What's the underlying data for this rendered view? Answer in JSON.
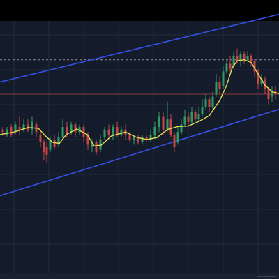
{
  "theme": {
    "top_bar": "#000000",
    "panel_bg": "#141c2b",
    "grid": "#232b3b",
    "channel": "#3550e6",
    "ma": "#e7dc55",
    "up": "#2f9a66",
    "down": "#c64545",
    "dash_line": "#8c8f98",
    "red_hline": "#8a3a3e",
    "bottom_bar": "#1a2230"
  },
  "chart_data": {
    "type": "candlestick",
    "title": "",
    "xlabel": "",
    "ylabel": "",
    "grid": true,
    "x_range": [
      0,
      400
    ],
    "y_range": [
      0,
      100
    ],
    "channel_upper": [
      {
        "x": 0,
        "y": 75.8
      },
      {
        "x": 400,
        "y": 102.6
      }
    ],
    "channel_lower": [
      {
        "x": 0,
        "y": 30.8
      },
      {
        "x": 400,
        "y": 65.0
      }
    ],
    "resistance_dashed": 84.6,
    "red_horizontal": 71.0,
    "ma_points": [
      [
        0,
        55.0
      ],
      [
        20,
        56.0
      ],
      [
        40,
        57.8
      ],
      [
        55,
        57.5
      ],
      [
        65,
        54.5
      ],
      [
        75,
        52.0
      ],
      [
        85,
        51.5
      ],
      [
        95,
        55.0
      ],
      [
        110,
        57.2
      ],
      [
        125,
        55.0
      ],
      [
        135,
        50.5
      ],
      [
        145,
        50.8
      ],
      [
        160,
        54.5
      ],
      [
        180,
        56.0
      ],
      [
        195,
        54.0
      ],
      [
        210,
        53.0
      ],
      [
        225,
        53.8
      ],
      [
        240,
        57.0
      ],
      [
        255,
        58.2
      ],
      [
        270,
        58.4
      ],
      [
        285,
        60.2
      ],
      [
        300,
        62.5
      ],
      [
        315,
        68.5
      ],
      [
        325,
        74.5
      ],
      [
        333,
        81.5
      ],
      [
        340,
        84.2
      ],
      [
        350,
        84.6
      ],
      [
        360,
        83.6
      ],
      [
        370,
        79.0
      ],
      [
        380,
        74.5
      ],
      [
        390,
        72.0
      ],
      [
        400,
        71.2
      ]
    ],
    "candles": [
      [
        4,
        57,
        56,
        58,
        55
      ],
      [
        10,
        55,
        57,
        58,
        54
      ],
      [
        16,
        58,
        55,
        59,
        54
      ],
      [
        22,
        56,
        59,
        60,
        55
      ],
      [
        28,
        58,
        57,
        62,
        55
      ],
      [
        34,
        57,
        59,
        61,
        56
      ],
      [
        40,
        59,
        57,
        61,
        56
      ],
      [
        46,
        57,
        60,
        62,
        55
      ],
      [
        52,
        59,
        56,
        60,
        54
      ],
      [
        58,
        55,
        52,
        56,
        50
      ],
      [
        63,
        52,
        48,
        53,
        45
      ],
      [
        67,
        50,
        47,
        52,
        44
      ],
      [
        72,
        49,
        53,
        54,
        48
      ],
      [
        78,
        53,
        50,
        55,
        49
      ],
      [
        84,
        51,
        54,
        56,
        50
      ],
      [
        90,
        54,
        58,
        61,
        53
      ],
      [
        96,
        58,
        55,
        60,
        54
      ],
      [
        102,
        56,
        59,
        60,
        55
      ],
      [
        108,
        59,
        56,
        60,
        54
      ],
      [
        114,
        56,
        58,
        59,
        55
      ],
      [
        120,
        58,
        54,
        59,
        52
      ],
      [
        126,
        55,
        51,
        56,
        49
      ],
      [
        132,
        50,
        52,
        53,
        48
      ],
      [
        138,
        52,
        48,
        53,
        47
      ],
      [
        144,
        49,
        53,
        55,
        48
      ],
      [
        150,
        54,
        57,
        58,
        53
      ],
      [
        156,
        57,
        55,
        59,
        54
      ],
      [
        162,
        55,
        58,
        59,
        53
      ],
      [
        168,
        58,
        55,
        60,
        54
      ],
      [
        174,
        55,
        57,
        58,
        54
      ],
      [
        180,
        57,
        55,
        59,
        53
      ],
      [
        186,
        55,
        53,
        56,
        52
      ],
      [
        192,
        53,
        54,
        55,
        51
      ],
      [
        198,
        54,
        52,
        55,
        51
      ],
      [
        204,
        52,
        54,
        55,
        51
      ],
      [
        210,
        54,
        53,
        55,
        52
      ],
      [
        216,
        53,
        55,
        57,
        52
      ],
      [
        222,
        55,
        58,
        60,
        54
      ],
      [
        228,
        58,
        62,
        64,
        56
      ],
      [
        234,
        62,
        57,
        64,
        55
      ],
      [
        240,
        57,
        61,
        68,
        56
      ],
      [
        245,
        61,
        55,
        63,
        54
      ],
      [
        250,
        55,
        50,
        56,
        48
      ],
      [
        255,
        52,
        56,
        58,
        51
      ],
      [
        260,
        56,
        59,
        61,
        55
      ],
      [
        265,
        59,
        62,
        65,
        58
      ],
      [
        270,
        62,
        60,
        64,
        58
      ],
      [
        275,
        60,
        64,
        66,
        59
      ],
      [
        280,
        64,
        61,
        65,
        60
      ],
      [
        285,
        61,
        63,
        66,
        60
      ],
      [
        290,
        63,
        66,
        69,
        62
      ],
      [
        295,
        66,
        69,
        71,
        65
      ],
      [
        300,
        69,
        66,
        70,
        64
      ],
      [
        305,
        66,
        70,
        72,
        65
      ],
      [
        310,
        71,
        76,
        79,
        70
      ],
      [
        315,
        76,
        73,
        78,
        71
      ],
      [
        320,
        74,
        80,
        82,
        73
      ],
      [
        325,
        80,
        83,
        85,
        79
      ],
      [
        330,
        83,
        81,
        86,
        80
      ],
      [
        335,
        82,
        86,
        88,
        81
      ],
      [
        340,
        86,
        84,
        89,
        83
      ],
      [
        345,
        84,
        87,
        88,
        82
      ],
      [
        350,
        87,
        85,
        88,
        83
      ],
      [
        355,
        85,
        86,
        88,
        84
      ],
      [
        360,
        86,
        84,
        87,
        82
      ],
      [
        365,
        84,
        80,
        85,
        78
      ],
      [
        370,
        80,
        75,
        81,
        73
      ],
      [
        375,
        75,
        77,
        79,
        74
      ],
      [
        380,
        77,
        73,
        78,
        71
      ],
      [
        385,
        73,
        69,
        74,
        67
      ],
      [
        390,
        70,
        72,
        74,
        68
      ],
      [
        395,
        72,
        71,
        74,
        69
      ]
    ]
  }
}
